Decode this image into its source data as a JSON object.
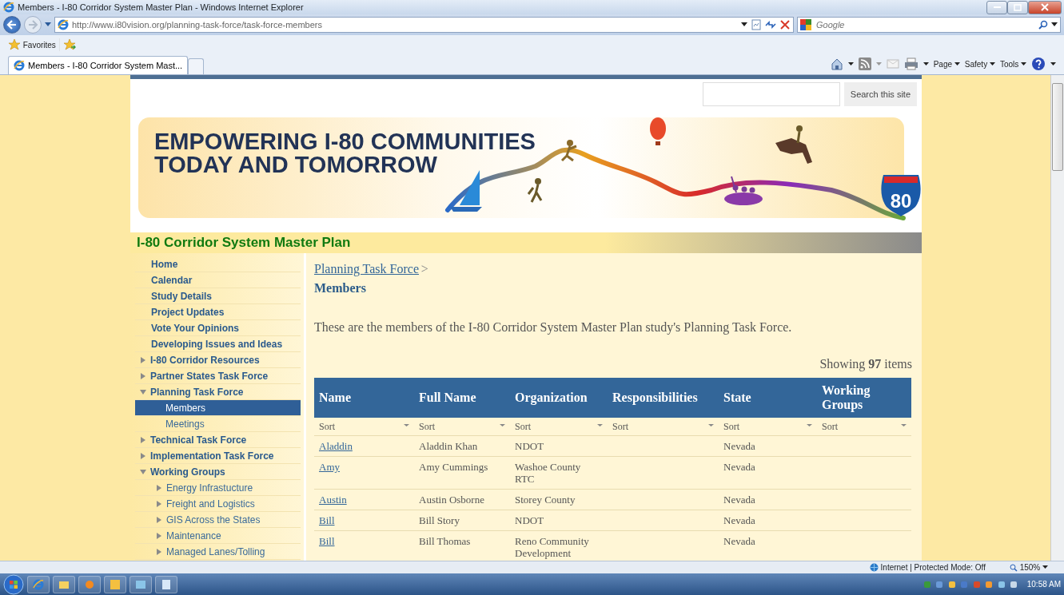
{
  "window": {
    "title": "Members - I-80 Corridor System Master Plan - Windows Internet Explorer"
  },
  "address_bar": {
    "url": "http://www.i80vision.org/planning-task-force/task-force-members",
    "search_placeholder": "Google"
  },
  "favorites_bar": {
    "favorites": "Favorites"
  },
  "tabs": [
    {
      "label": "Members - I-80 Corridor System Mast...",
      "selected": true
    }
  ],
  "command_bar": [
    "Page",
    "Safety",
    "Tools"
  ],
  "site": {
    "search_button": "Search this site",
    "headline": [
      "EMPOWERING I-80 COMMUNITIES",
      "TODAY AND TOMORROW"
    ],
    "shield_number": "80",
    "site_title": "I-80 Corridor System Master Plan"
  },
  "sidebar": {
    "items": [
      {
        "label": "Home",
        "kind": "plain",
        "selected": false
      },
      {
        "label": "Calendar",
        "kind": "plain",
        "selected": false
      },
      {
        "label": "Study Details",
        "kind": "plain",
        "selected": false
      },
      {
        "label": "Project Updates",
        "kind": "plain",
        "selected": false
      },
      {
        "label": "Vote Your Opinions",
        "kind": "plain",
        "selected": false
      },
      {
        "label": "Developing Issues and Ideas",
        "kind": "plain",
        "selected": false
      },
      {
        "label": "I-80 Corridor Resources",
        "kind": "tree",
        "expanded": false,
        "selected": false
      },
      {
        "label": "Partner States Task Force",
        "kind": "tree",
        "expanded": false,
        "selected": false
      },
      {
        "label": "Planning Task Force",
        "kind": "tree",
        "expanded": true,
        "selected": false,
        "children": [
          {
            "label": "Members",
            "kind": "plain",
            "selected": true
          },
          {
            "label": "Meetings",
            "kind": "plain",
            "selected": false
          }
        ]
      },
      {
        "label": "Technical Task Force",
        "kind": "tree",
        "expanded": false,
        "selected": false
      },
      {
        "label": "Implementation Task Force",
        "kind": "tree",
        "expanded": false,
        "selected": false
      },
      {
        "label": "Working Groups",
        "kind": "tree",
        "expanded": true,
        "selected": false,
        "children": [
          {
            "label": "Energy Infrastucture",
            "kind": "tree",
            "expanded": false,
            "selected": false
          },
          {
            "label": "Freight and Logistics",
            "kind": "tree",
            "expanded": false,
            "selected": false
          },
          {
            "label": "GIS Across the States",
            "kind": "tree",
            "expanded": false,
            "selected": false
          },
          {
            "label": "Maintenance",
            "kind": "tree",
            "expanded": false,
            "selected": false
          },
          {
            "label": "Managed Lanes/Tolling",
            "kind": "tree",
            "expanded": false,
            "selected": false
          }
        ]
      }
    ]
  },
  "content": {
    "breadcrumb": {
      "link": "Planning Task Force",
      "separator": ">"
    },
    "heading": "Members",
    "intro": "These are the members of the I-80 Corridor System Master Plan study's Planning Task Force.",
    "count": "Showing **97** items",
    "table": {
      "columns": [
        {
          "label": "Name",
          "sort": "Sort"
        },
        {
          "label": "Full Name",
          "sort": "Sort"
        },
        {
          "label": "Organization",
          "sort": "Sort"
        },
        {
          "label": "Responsibilities",
          "sort": "Sort"
        },
        {
          "label": "State",
          "sort": "Sort"
        },
        {
          "label": "Working Groups",
          "sort": "Sort"
        }
      ],
      "rows": [
        {
          "name": "Aladdin",
          "full_name": "Aladdin Khan",
          "organization": "NDOT",
          "state": "Nevada"
        },
        {
          "name": "Amy",
          "full_name": "Amy Cummings",
          "organization": "Washoe County RTC",
          "state": "Nevada"
        },
        {
          "name": "Austin",
          "full_name": "Austin Osborne",
          "organization": "Storey County",
          "state": "Nevada"
        },
        {
          "name": "Bill",
          "full_name": "Bill Story",
          "organization": "NDOT",
          "state": "Nevada"
        },
        {
          "name": "Bill",
          "full_name": "Bill Thomas",
          "organization": "Reno Community Development",
          "state": "Nevada"
        }
      ]
    }
  },
  "status_bar": {
    "zone": "Internet | Protected Mode: Off",
    "zoom": "150%"
  },
  "taskbar": {
    "clock": "10:58 AM"
  }
}
